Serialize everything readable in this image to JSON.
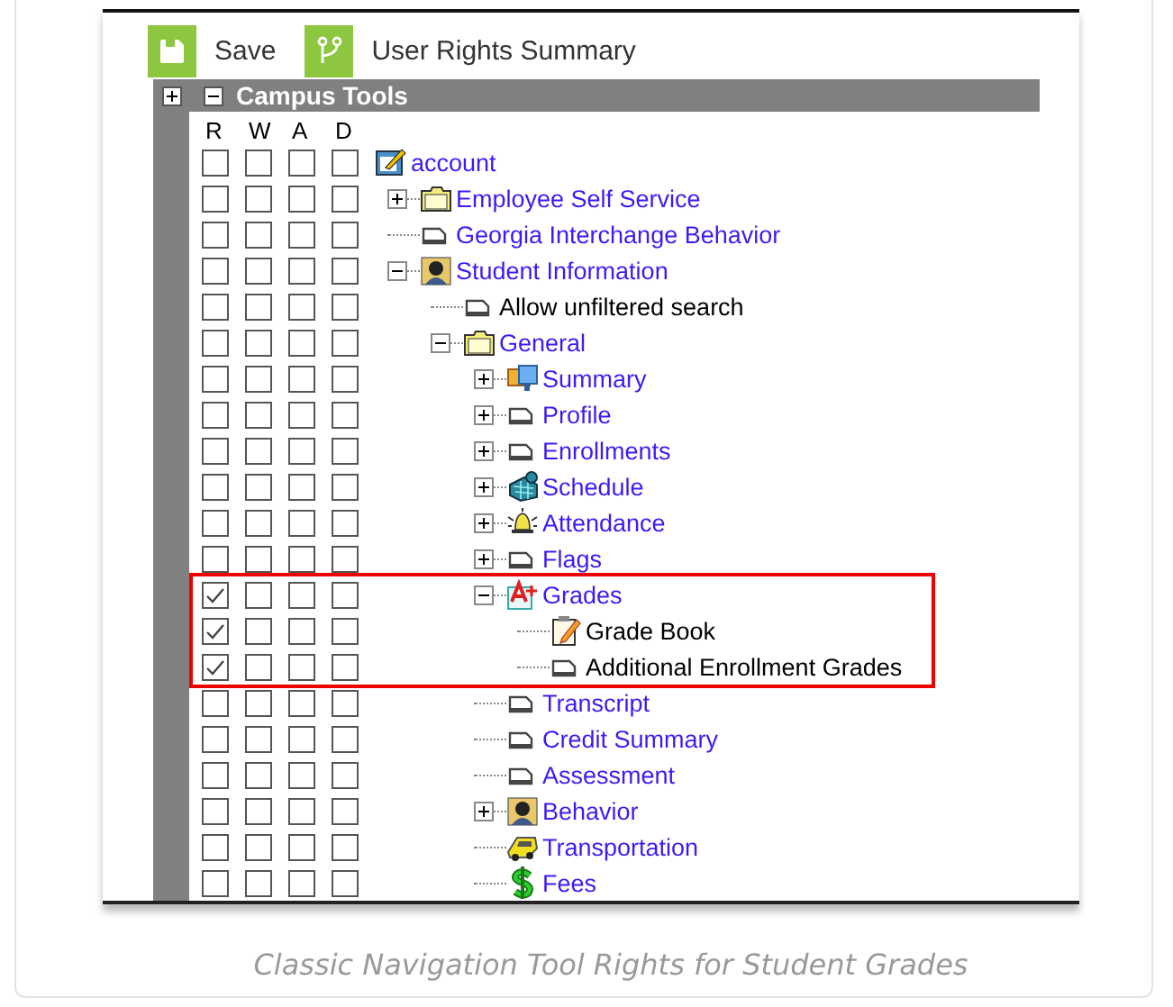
{
  "toolbar": {
    "buttons": [
      {
        "label": "Save",
        "kind": "save"
      },
      {
        "label": "User Rights Summary",
        "kind": "branch"
      }
    ]
  },
  "panel": {
    "title": "Campus Tools",
    "expanded": true,
    "rights_columns": [
      "R",
      "W",
      "A",
      "D"
    ],
    "tree": [
      {
        "label": "account",
        "link": true,
        "kind": "account",
        "rights": [
          false,
          false,
          false,
          false
        ],
        "children": [
          {
            "label": "Employee Self Service",
            "link": true,
            "kind": "folder",
            "expanded": false,
            "rights": [
              false,
              false,
              false,
              false
            ]
          },
          {
            "label": "Georgia Interchange Behavior",
            "link": true,
            "kind": "page",
            "rights": [
              false,
              false,
              false,
              false
            ]
          },
          {
            "label": "Student Information",
            "link": true,
            "kind": "person",
            "expanded": true,
            "rights": [
              false,
              false,
              false,
              false
            ],
            "children": [
              {
                "label": "Allow unfiltered search",
                "link": false,
                "kind": "page",
                "rights": [
                  false,
                  false,
                  false,
                  false
                ]
              },
              {
                "label": "General",
                "link": true,
                "kind": "folder",
                "expanded": true,
                "rights": [
                  false,
                  false,
                  false,
                  false
                ],
                "children": [
                  {
                    "label": "Summary",
                    "link": true,
                    "kind": "monitor",
                    "expanded": false,
                    "rights": [
                      false,
                      false,
                      false,
                      false
                    ]
                  },
                  {
                    "label": "Profile",
                    "link": true,
                    "kind": "page",
                    "expanded": false,
                    "rights": [
                      false,
                      false,
                      false,
                      false
                    ]
                  },
                  {
                    "label": "Enrollments",
                    "link": true,
                    "kind": "page",
                    "expanded": false,
                    "rights": [
                      false,
                      false,
                      false,
                      false
                    ]
                  },
                  {
                    "label": "Schedule",
                    "link": true,
                    "kind": "calendar",
                    "expanded": false,
                    "rights": [
                      false,
                      false,
                      false,
                      false
                    ]
                  },
                  {
                    "label": "Attendance",
                    "link": true,
                    "kind": "bell",
                    "expanded": false,
                    "rights": [
                      false,
                      false,
                      false,
                      false
                    ]
                  },
                  {
                    "label": "Flags",
                    "link": true,
                    "kind": "page",
                    "expanded": false,
                    "rights": [
                      false,
                      false,
                      false,
                      false
                    ]
                  },
                  {
                    "label": "Grades",
                    "link": true,
                    "kind": "grades",
                    "expanded": true,
                    "highlighted": true,
                    "rights": [
                      true,
                      false,
                      false,
                      false
                    ],
                    "children": [
                      {
                        "label": "Grade Book",
                        "link": false,
                        "kind": "notepad",
                        "rights": [
                          true,
                          false,
                          false,
                          false
                        ]
                      },
                      {
                        "label": "Additional Enrollment Grades",
                        "link": false,
                        "kind": "page",
                        "rights": [
                          true,
                          false,
                          false,
                          false
                        ]
                      }
                    ]
                  },
                  {
                    "label": "Transcript",
                    "link": true,
                    "kind": "page",
                    "rights": [
                      false,
                      false,
                      false,
                      false
                    ]
                  },
                  {
                    "label": "Credit Summary",
                    "link": true,
                    "kind": "page",
                    "rights": [
                      false,
                      false,
                      false,
                      false
                    ]
                  },
                  {
                    "label": "Assessment",
                    "link": true,
                    "kind": "page",
                    "rights": [
                      false,
                      false,
                      false,
                      false
                    ]
                  },
                  {
                    "label": "Behavior",
                    "link": true,
                    "kind": "person",
                    "expanded": false,
                    "rights": [
                      false,
                      false,
                      false,
                      false
                    ]
                  },
                  {
                    "label": "Transportation",
                    "link": true,
                    "kind": "bus",
                    "rights": [
                      false,
                      false,
                      false,
                      false
                    ]
                  },
                  {
                    "label": "Fees",
                    "link": true,
                    "kind": "dollar",
                    "rights": [
                      false,
                      false,
                      false,
                      false
                    ]
                  }
                ]
              }
            ]
          }
        ]
      }
    ]
  },
  "caption": "Classic Navigation Tool Rights for Student Grades"
}
